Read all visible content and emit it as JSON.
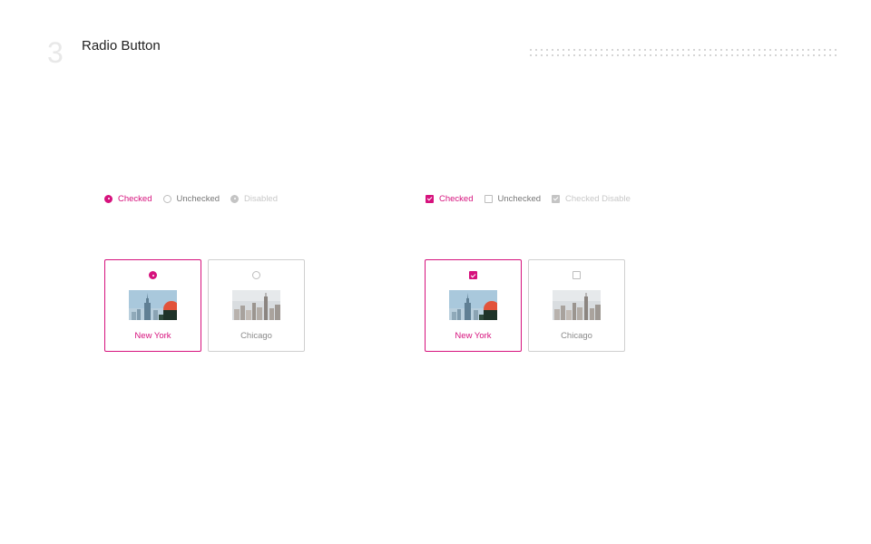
{
  "header": {
    "section_number": "3",
    "title": "Radio Button"
  },
  "radio_options": [
    {
      "label": "Checked",
      "state": "checked"
    },
    {
      "label": "Unchecked",
      "state": "unchecked"
    },
    {
      "label": "Disabled",
      "state": "disabled"
    }
  ],
  "checkbox_options": [
    {
      "label": "Checked",
      "state": "checked"
    },
    {
      "label": "Unchecked",
      "state": "unchecked"
    },
    {
      "label": "Checked Disable",
      "state": "checked-disabled"
    }
  ],
  "radio_cards": [
    {
      "city": "New York",
      "selected": true,
      "image": "new-york-skyline-photo"
    },
    {
      "city": "Chicago",
      "selected": false,
      "image": "chicago-skyline-photo"
    }
  ],
  "checkbox_cards": [
    {
      "city": "New York",
      "selected": true,
      "image": "new-york-skyline-photo"
    },
    {
      "city": "Chicago",
      "selected": false,
      "image": "chicago-skyline-photo"
    }
  ],
  "colors": {
    "accent": "#d6127d",
    "border": "#cfcfcf",
    "disabled": "#c4c4c4",
    "muted_text": "#777777"
  }
}
